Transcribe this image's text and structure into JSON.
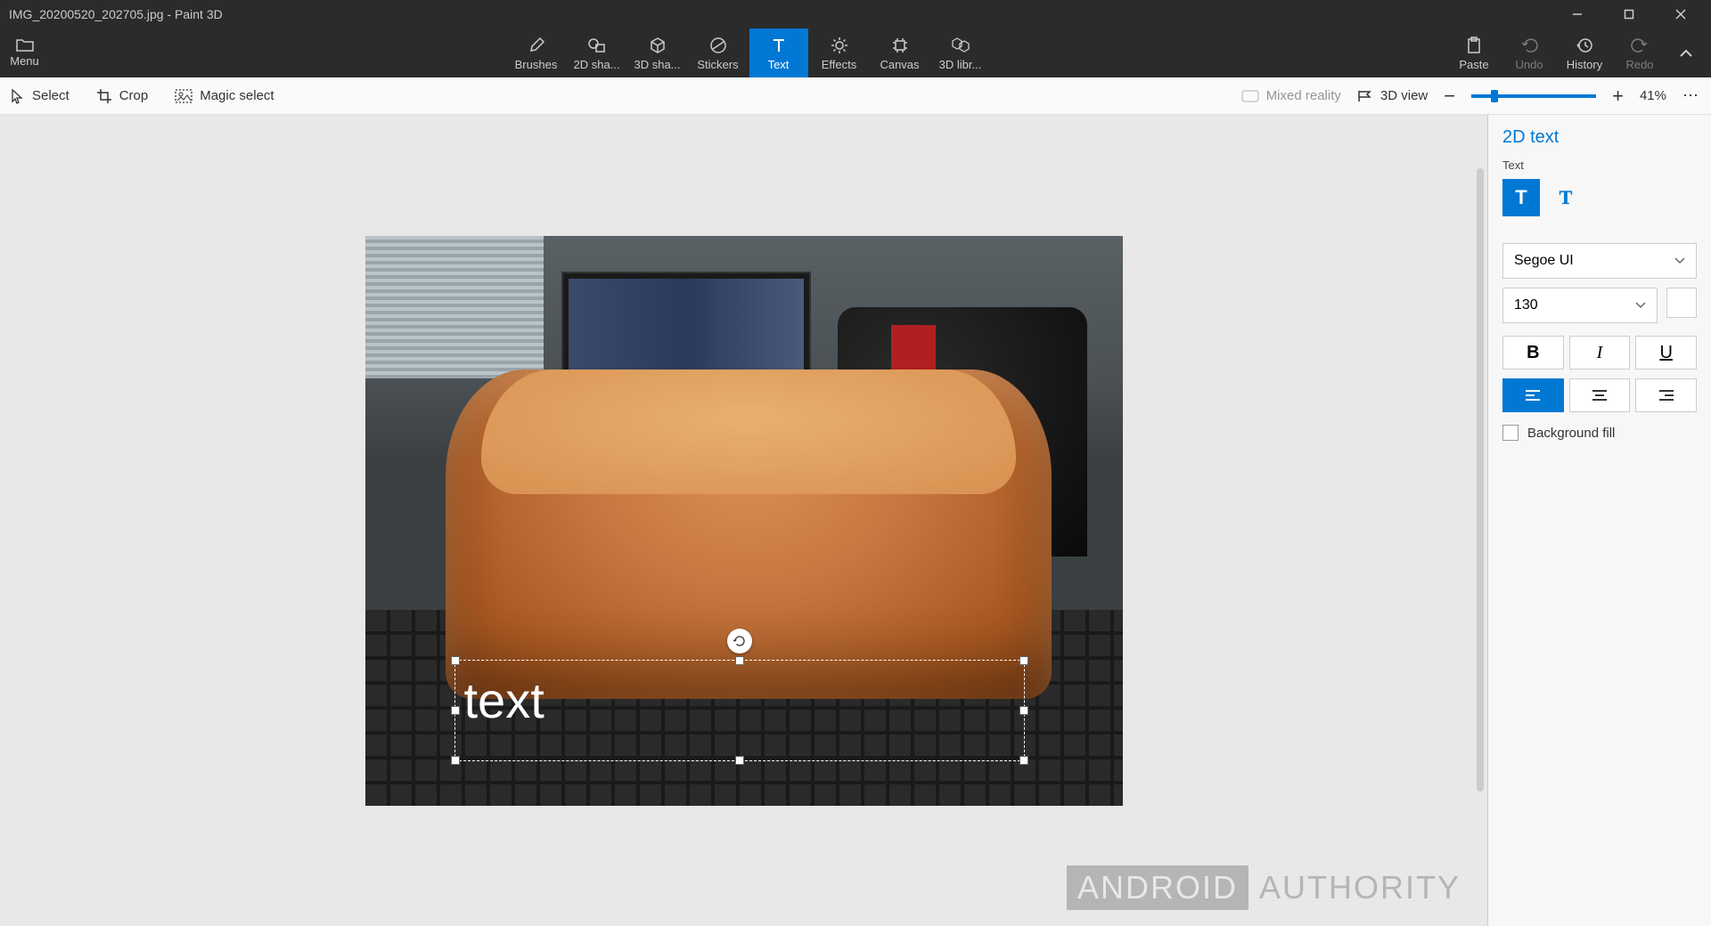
{
  "title": "IMG_20200520_202705.jpg - Paint 3D",
  "menu": {
    "label": "Menu"
  },
  "tools": [
    {
      "id": "brushes",
      "label": "Brushes"
    },
    {
      "id": "2d-shapes",
      "label": "2D sha..."
    },
    {
      "id": "3d-shapes",
      "label": "3D sha..."
    },
    {
      "id": "stickers",
      "label": "Stickers"
    },
    {
      "id": "text",
      "label": "Text"
    },
    {
      "id": "effects",
      "label": "Effects"
    },
    {
      "id": "canvas",
      "label": "Canvas"
    },
    {
      "id": "3d-library",
      "label": "3D libr..."
    }
  ],
  "rightTools": {
    "paste": "Paste",
    "undo": "Undo",
    "history": "History",
    "redo": "Redo"
  },
  "toolbar": {
    "select": "Select",
    "crop": "Crop",
    "magicSelect": "Magic select",
    "mixedReality": "Mixed reality",
    "view3d": "3D view",
    "zoom": "41%"
  },
  "canvas": {
    "textContent": "text"
  },
  "panel": {
    "title": "2D text",
    "sub": "Text",
    "font": "Segoe UI",
    "size": "130",
    "bgFill": "Background fill"
  },
  "watermark": {
    "brand": "ANDROID",
    "name": "AUTHORITY"
  }
}
